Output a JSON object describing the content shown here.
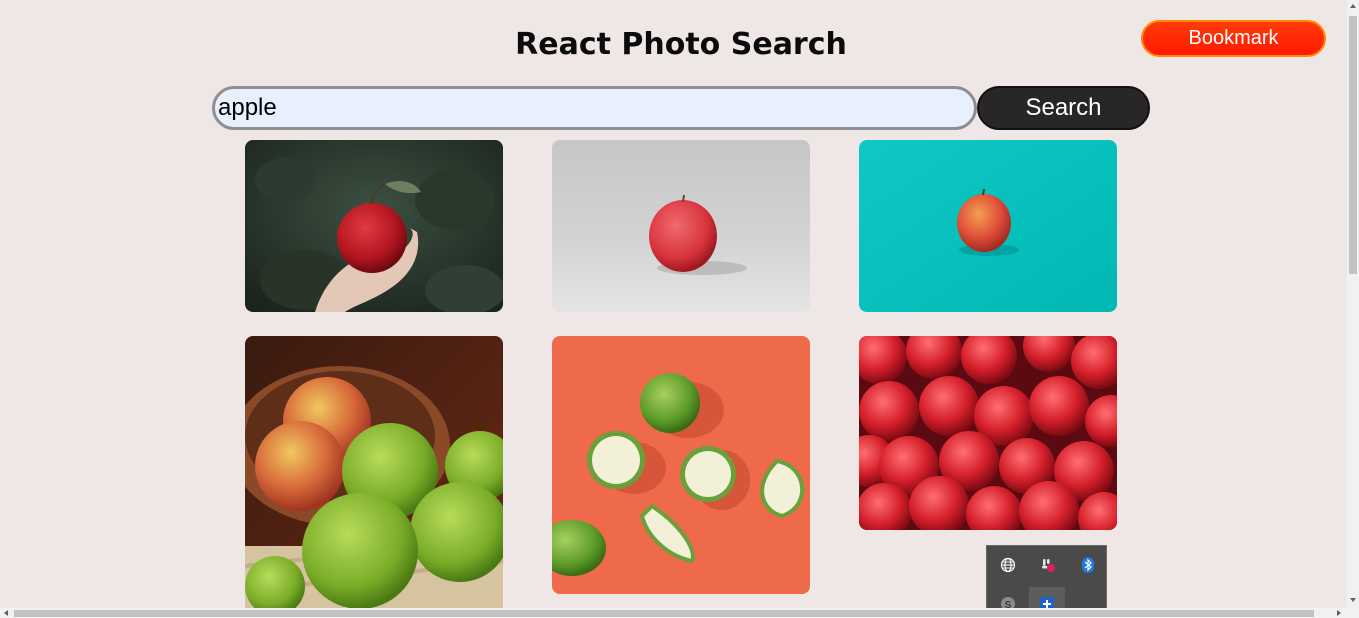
{
  "header": {
    "title": "React Photo Search",
    "bookmark_label": "Bookmark"
  },
  "search": {
    "value": "apple",
    "button_label": "Search"
  },
  "photos": [
    {
      "subject": "hand holding red apple on tree"
    },
    {
      "subject": "red apple on grey background"
    },
    {
      "subject": "apple on teal background"
    },
    {
      "subject": "bowl of green and red apples"
    },
    {
      "subject": "sliced green apples on orange background"
    },
    {
      "subject": "pile of red apples"
    }
  ],
  "tray": {
    "icons": [
      "globe-icon",
      "slack-icon",
      "bluetooth-icon",
      "skype-icon",
      "add-icon"
    ]
  },
  "colors": {
    "background": "#efe6e6",
    "bookmark": "#ff2200",
    "search_button": "#282626",
    "input_fill": "#e8f0fe"
  }
}
